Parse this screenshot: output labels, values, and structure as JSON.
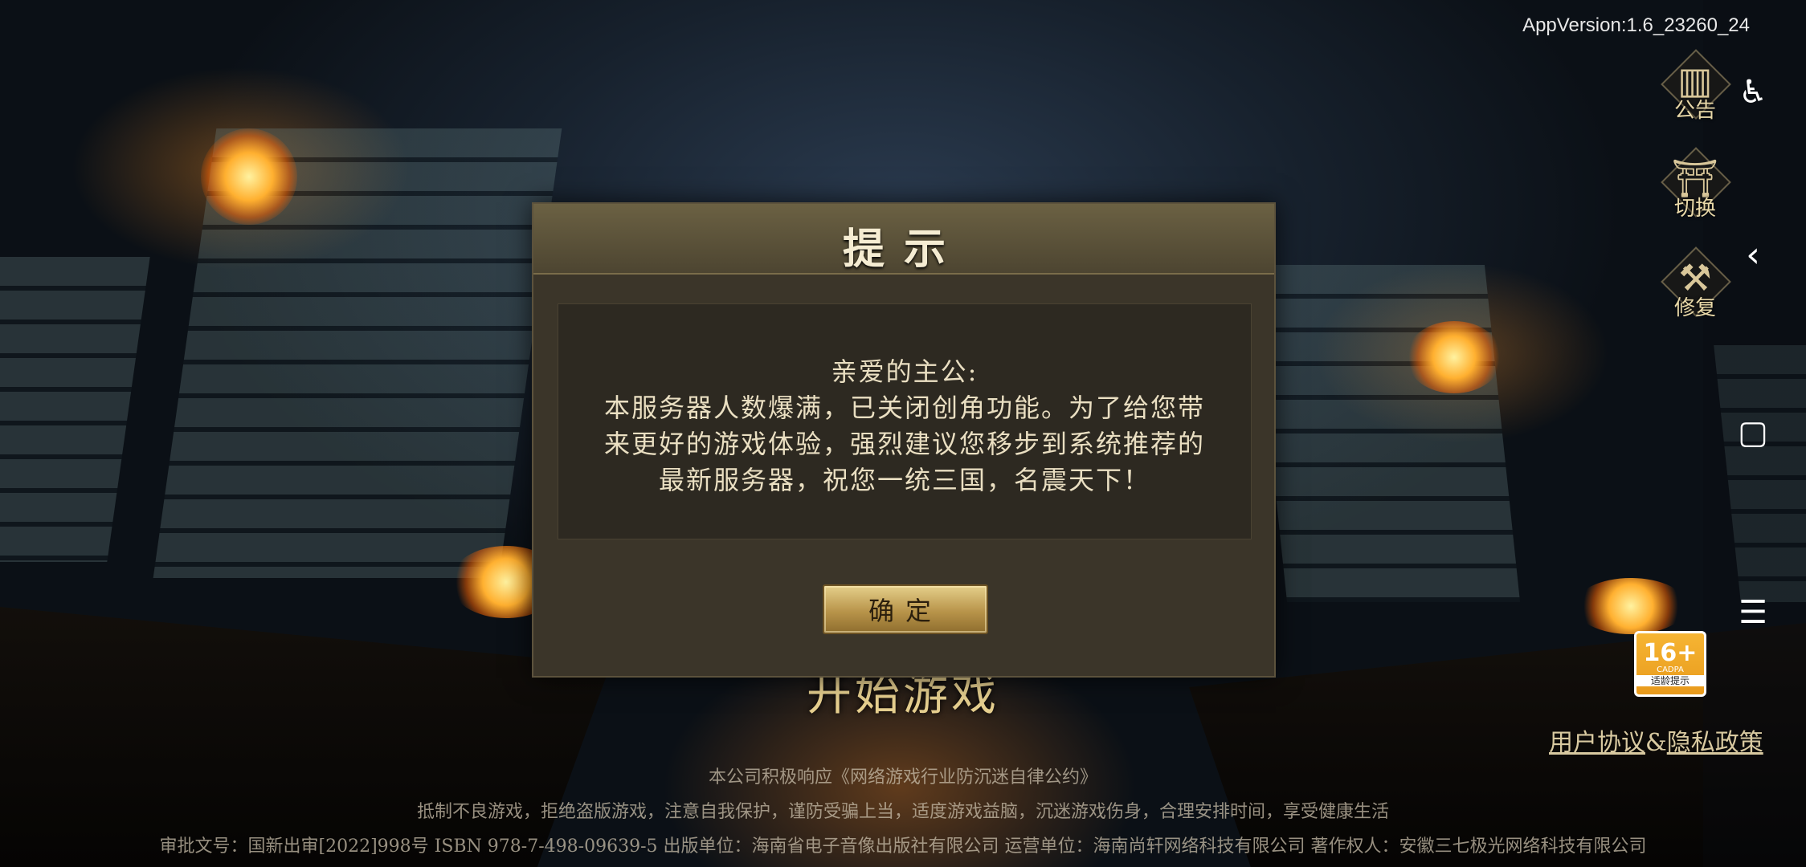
{
  "app_version": "AppVersion:1.6_23260_24",
  "side_menu": [
    {
      "label": "公告",
      "icon": "bulletin-icon"
    },
    {
      "label": "切换",
      "icon": "gate-icon"
    },
    {
      "label": "修复",
      "icon": "repair-tools-icon"
    }
  ],
  "system_icons": {
    "accessibility": "accessibility-icon",
    "back": "back-chevron-icon",
    "home": "home-square-icon",
    "menu": "menu-lines-icon"
  },
  "age_rating": {
    "age": "16+",
    "org": "CADPA",
    "tip": "适龄提示"
  },
  "policy": {
    "user_agreement": "用户协议",
    "amp": "&",
    "privacy_policy": "隐私政策"
  },
  "start_game": "开始游戏",
  "footer": {
    "line1": "本公司积极响应《网络游戏行业防沉迷自律公约》",
    "line2": "抵制不良游戏，拒绝盗版游戏，注意自我保护，谨防受骗上当，适度游戏益脑，沉迷游戏伤身，合理安排时间，享受健康生活",
    "line3": "审批文号：国新出审[2022]998号 ISBN 978-7-498-09639-5 出版单位：海南省电子音像出版社有限公司 运营单位：海南尚轩网络科技有限公司 著作权人：安徽三七极光网络科技有限公司"
  },
  "dialog": {
    "title": "提示",
    "greeting": "亲爱的主公:",
    "line1": "本服务器人数爆满，已关闭创角功能。为了给您带",
    "line2": "来更好的游戏体验，强烈建议您移步到系统推荐的",
    "line3": "最新服务器，祝您一统三国，名震天下！",
    "confirm": "确定"
  }
}
